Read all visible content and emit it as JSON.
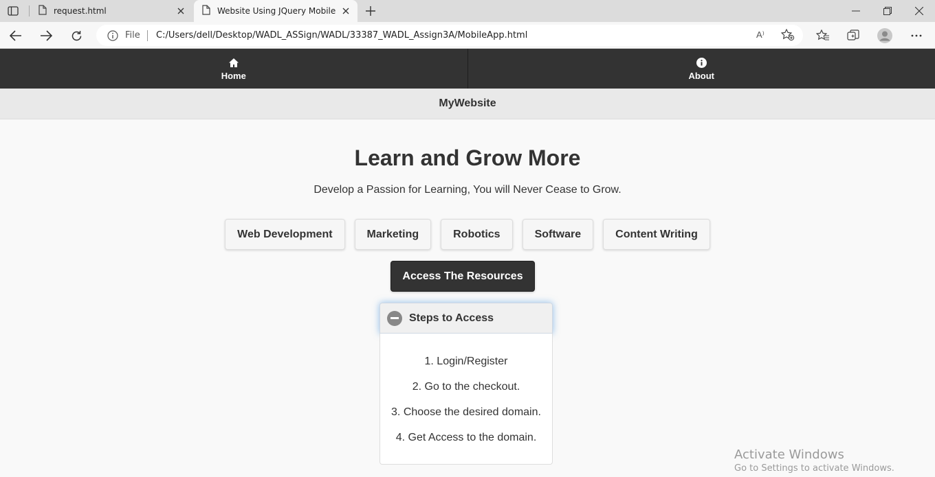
{
  "browser": {
    "tabs": [
      {
        "title": "request.html",
        "active": false
      },
      {
        "title": "Website Using JQuery Mobile",
        "active": true
      }
    ],
    "address": {
      "scheme_label": "File",
      "url": "C:/Users/dell/Desktop/WADL_ASSign/WADL/33387_WADL_Assign3A/MobileApp.html"
    },
    "read_aloud_label": "A⁾"
  },
  "navbar": {
    "items": [
      {
        "label": "Home",
        "icon": "home-icon"
      },
      {
        "label": "About",
        "icon": "info-icon"
      }
    ]
  },
  "header": {
    "title": "MyWebsite"
  },
  "main": {
    "headline": "Learn and Grow More",
    "subtitle": "Develop a Passion for Learning, You will Never Cease to Grow.",
    "topics": [
      "Web Development",
      "Marketing",
      "Robotics",
      "Software",
      "Content Writing"
    ],
    "access_button": "Access The Resources",
    "collapsible": {
      "title": "Steps to Access",
      "expanded": true,
      "steps": [
        "1. Login/Register",
        "2. Go to the checkout.",
        "3. Choose the desired domain.",
        "4. Get Access to the domain."
      ]
    }
  },
  "watermark": {
    "line1": "Activate Windows",
    "line2": "Go to Settings to activate Windows."
  },
  "colors": {
    "navbar_bg": "#333333",
    "header_bg": "#e9e9e9",
    "page_bg": "#f9f9f9",
    "focus_glow": "#388cdc"
  }
}
